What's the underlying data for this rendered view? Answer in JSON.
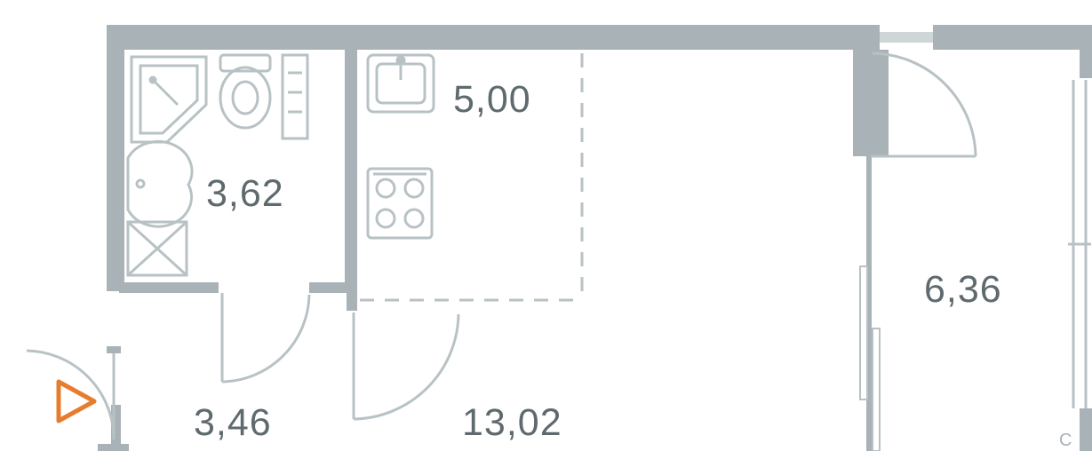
{
  "rooms": {
    "bathroom": {
      "area": "3,62"
    },
    "kitchen": {
      "area": "5,00"
    },
    "hall": {
      "area": "3,46"
    },
    "living": {
      "area": "13,02"
    },
    "balcony": {
      "area": "6,36"
    }
  },
  "compass": {
    "label": "С"
  },
  "colors": {
    "wall_outer": "#a9b2b6",
    "wall_light": "#cfd6d8",
    "fixture": "#b8c2c5",
    "accent": "#e77c2f"
  }
}
